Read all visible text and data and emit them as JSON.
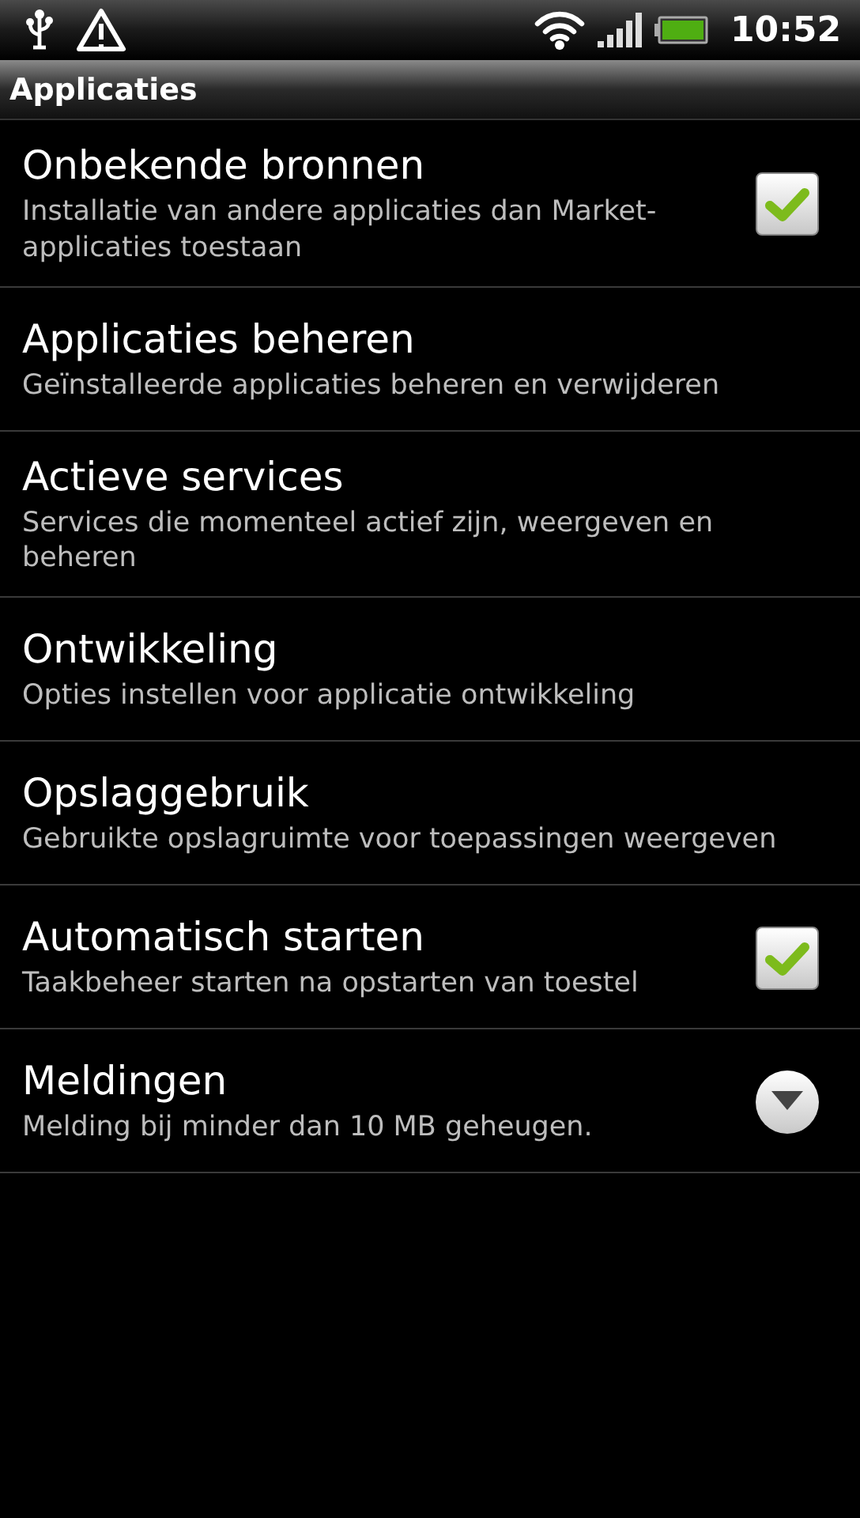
{
  "status_bar": {
    "time": "10:52"
  },
  "title_bar": {
    "title": "Applicaties"
  },
  "settings": [
    {
      "kind": "checkbox",
      "title": "Onbekende bronnen",
      "summary": "Installatie van andere applicaties dan Market-applicaties toestaan",
      "checked": true
    },
    {
      "kind": "plain",
      "title": "Applicaties beheren",
      "summary": "Geïnstalleerde applicaties beheren en verwijderen"
    },
    {
      "kind": "plain",
      "title": "Actieve services",
      "summary": "Services die momenteel actief zijn, weergeven en beheren"
    },
    {
      "kind": "plain",
      "title": "Ontwikkeling",
      "summary": "Opties instellen voor applicatie ontwikkeling"
    },
    {
      "kind": "plain",
      "title": "Opslaggebruik",
      "summary": "Gebruikte opslagruimte voor toepassingen weergeven"
    },
    {
      "kind": "checkbox",
      "title": "Automatisch starten",
      "summary": "Taakbeheer starten na opstarten van toestel",
      "checked": true
    },
    {
      "kind": "dropdown",
      "title": "Meldingen",
      "summary": "Melding bij minder dan 10 MB geheugen."
    }
  ]
}
